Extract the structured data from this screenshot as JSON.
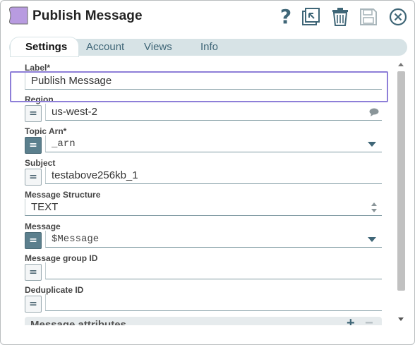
{
  "header": {
    "title": "Publish Message",
    "icons": [
      "snap-type-icon",
      "help-icon",
      "export-icon",
      "delete-icon",
      "save-icon",
      "close-icon"
    ],
    "help_glyph": "?"
  },
  "tabs": [
    {
      "label": "Settings",
      "active": true
    },
    {
      "label": "Account",
      "active": false
    },
    {
      "label": "Views",
      "active": false
    },
    {
      "label": "Info",
      "active": false
    }
  ],
  "form": {
    "label": {
      "title": "Label*",
      "value": "Publish Message"
    },
    "region": {
      "title": "Region",
      "value": "us-west-2",
      "expression": false
    },
    "topic_arn": {
      "title": "Topic Arn*",
      "value": "_arn",
      "expression": true
    },
    "subject": {
      "title": "Subject",
      "value": "testabove256kb_1",
      "expression": false
    },
    "message_structure": {
      "title": "Message Structure",
      "value": "TEXT"
    },
    "message": {
      "title": "Message",
      "value": "$Message",
      "expression": true
    },
    "message_group_id": {
      "title": "Message group ID",
      "value": "",
      "expression": false
    },
    "deduplicate_id": {
      "title": "Deduplicate ID",
      "value": "",
      "expression": false
    },
    "message_attributes": {
      "title": "Message attributes",
      "add": "+",
      "remove": "−"
    }
  },
  "eq_glyph": "=",
  "colors": {
    "accent": "#3f6677",
    "snap_purple": "#b89be0",
    "highlight": "#8e7fd8",
    "tabbar": "#d7e3e6",
    "expr_on": "#5b7f8d"
  }
}
